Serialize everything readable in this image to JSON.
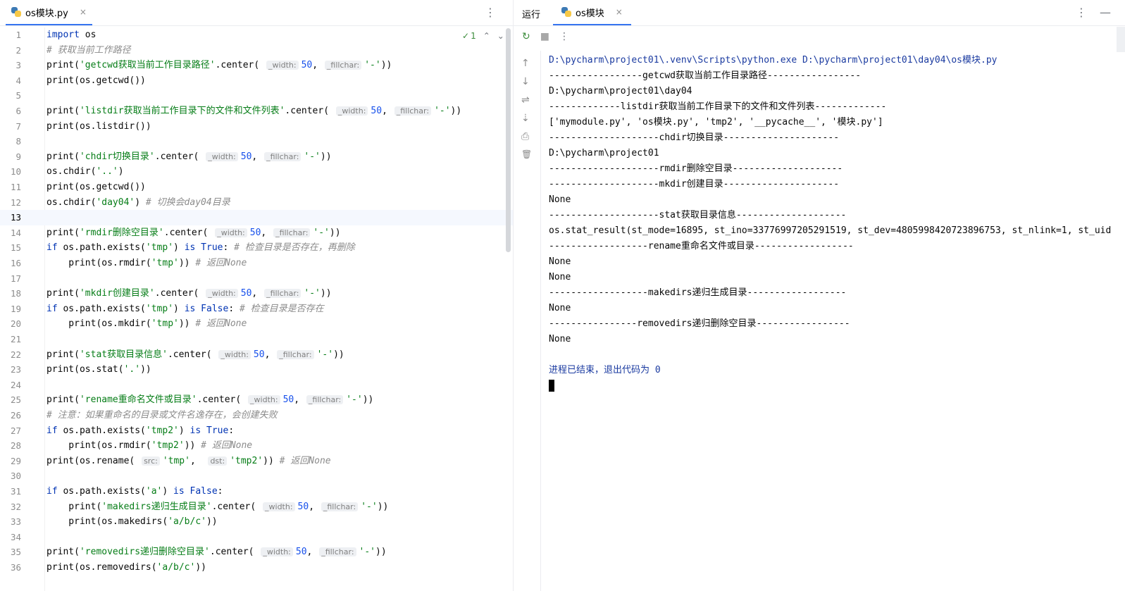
{
  "editor": {
    "tab": {
      "filename": "os模块.py",
      "close": "×"
    },
    "more_icon": "⋮",
    "inspection": {
      "count": "1",
      "up": "⌃",
      "down": "⌄"
    },
    "lines": [
      {
        "n": "1",
        "html": "<span class=\"kw\">import</span> os"
      },
      {
        "n": "2",
        "html": "<span class=\"cm\"># 获取当前工作路径</span>"
      },
      {
        "n": "3",
        "html": "print(<span class=\"str\">'getcwd获取当前工作目录路径'</span>.center( <span class=\"hint\">_width:</span><span class=\"num\">50</span>, <span class=\"hint\">_fillchar:</span><span class=\"str\">'-'</span>))"
      },
      {
        "n": "4",
        "html": "print(os.getcwd())"
      },
      {
        "n": "5",
        "html": ""
      },
      {
        "n": "6",
        "html": "print(<span class=\"str\">'listdir获取当前工作目录下的文件和文件列表'</span>.center( <span class=\"hint\">_width:</span><span class=\"num\">50</span>, <span class=\"hint\">_fillchar:</span><span class=\"str\">'-'</span>))"
      },
      {
        "n": "7",
        "html": "print(os.listdir())"
      },
      {
        "n": "8",
        "html": ""
      },
      {
        "n": "9",
        "html": "print(<span class=\"str\">'chdir切换目录'</span>.center( <span class=\"hint\">_width:</span><span class=\"num\">50</span>, <span class=\"hint\">_fillchar:</span><span class=\"str\">'-'</span>))"
      },
      {
        "n": "10",
        "html": "os.chdir(<span class=\"str\">'..'</span>)"
      },
      {
        "n": "11",
        "html": "print(os.getcwd())"
      },
      {
        "n": "12",
        "html": "os.chdir(<span class=\"str\">'day04'</span>) <span class=\"cm\"># 切换会day04目录</span>"
      },
      {
        "n": "13",
        "html": "",
        "current": true
      },
      {
        "n": "14",
        "html": "print(<span class=\"str\">'rmdir删除空目录'</span>.center( <span class=\"hint\">_width:</span><span class=\"num\">50</span>, <span class=\"hint\">_fillchar:</span><span class=\"str\">'-'</span>))"
      },
      {
        "n": "15",
        "html": "<span class=\"kw\">if</span> os.path.exists(<span class=\"str\">'tmp'</span>) <span class=\"kw\">is</span> <span class=\"kw\">True</span>: <span class=\"cm\"># 检查目录是否存在，再删除</span>"
      },
      {
        "n": "16",
        "html": "    print(os.rmdir(<span class=\"str\">'tmp'</span>)) <span class=\"cm\"># 返回None</span>"
      },
      {
        "n": "17",
        "html": ""
      },
      {
        "n": "18",
        "html": "print(<span class=\"str\">'mkdir创建目录'</span>.center( <span class=\"hint\">_width:</span><span class=\"num\">50</span>, <span class=\"hint\">_fillchar:</span><span class=\"str\">'-'</span>))"
      },
      {
        "n": "19",
        "html": "<span class=\"kw\">if</span> os.path.exists(<span class=\"str\">'tmp'</span>) <span class=\"kw\">is</span> <span class=\"kw\">False</span>: <span class=\"cm\"># 检查目录是否存在</span>"
      },
      {
        "n": "20",
        "html": "    print(os.mkdir(<span class=\"str\">'tmp'</span>)) <span class=\"cm\"># 返回None</span>"
      },
      {
        "n": "21",
        "html": ""
      },
      {
        "n": "22",
        "html": "print(<span class=\"str\">'stat获取目录信息'</span>.center( <span class=\"hint\">_width:</span><span class=\"num\">50</span>, <span class=\"hint\">_fillchar:</span><span class=\"str\">'-'</span>))"
      },
      {
        "n": "23",
        "html": "print(os.stat(<span class=\"str\">'.'</span>))"
      },
      {
        "n": "24",
        "html": ""
      },
      {
        "n": "25",
        "html": "print(<span class=\"str\">'rename重命名文件或目录'</span>.center( <span class=\"hint\">_width:</span><span class=\"num\">50</span>, <span class=\"hint\">_fillchar:</span><span class=\"str\">'-'</span>))"
      },
      {
        "n": "26",
        "html": "<span class=\"cm\"># 注意：如果重命名的目录或文件名逸存在，会创建失败</span>"
      },
      {
        "n": "27",
        "html": "<span class=\"kw\">if</span> os.path.exists(<span class=\"str\">'tmp2'</span>) <span class=\"kw\">is</span> <span class=\"kw\">True</span>:"
      },
      {
        "n": "28",
        "html": "    print(os.rmdir(<span class=\"str\">'tmp2'</span>)) <span class=\"cm\"># 返回None</span>"
      },
      {
        "n": "29",
        "html": "print(os.rename( <span class=\"hint\">src:</span><span class=\"str\">'tmp'</span>,  <span class=\"hint\">dst:</span><span class=\"str\">'tmp2'</span>)) <span class=\"cm\"># 返回None</span>"
      },
      {
        "n": "30",
        "html": ""
      },
      {
        "n": "31",
        "html": "<span class=\"kw\">if</span> os.path.exists(<span class=\"str\">'a'</span>) <span class=\"kw\">is</span> <span class=\"kw\">False</span>:"
      },
      {
        "n": "32",
        "html": "    print(<span class=\"str\">'makedirs递归生成目录'</span>.center( <span class=\"hint\">_width:</span><span class=\"num\">50</span>, <span class=\"hint\">_fillchar:</span><span class=\"str\">'-'</span>))"
      },
      {
        "n": "33",
        "html": "    print(os.makedirs(<span class=\"str\">'a/b/c'</span>))"
      },
      {
        "n": "34",
        "html": ""
      },
      {
        "n": "35",
        "html": "print(<span class=\"str\">'removedirs递归删除空目录'</span>.center( <span class=\"hint\">_width:</span><span class=\"num\">50</span>, <span class=\"hint\">_fillchar:</span><span class=\"str\">'-'</span>))"
      },
      {
        "n": "36",
        "html": "print(os.removedirs(<span class=\"str\">'a/b/c'</span>))"
      }
    ]
  },
  "run": {
    "label": "运行",
    "tab": {
      "title": "os模块",
      "close": "×"
    },
    "more_icon": "⋮",
    "minimize_icon": "—",
    "toolbar": {
      "rerun": "↻",
      "stop": "■",
      "more": "⋮"
    },
    "side_icons": [
      "↑",
      "↓",
      "⇌",
      "⇣",
      "⎙",
      "🗑"
    ],
    "console": [
      {
        "t": "D:\\pycharm\\project01\\.venv\\Scripts\\python.exe D:\\pycharm\\project01\\day04\\os模块.py",
        "cls": "path"
      },
      {
        "t": "-----------------getcwd获取当前工作目录路径-----------------"
      },
      {
        "t": "D:\\pycharm\\project01\\day04"
      },
      {
        "t": "-------------listdir获取当前工作目录下的文件和文件列表-------------"
      },
      {
        "t": "['mymodule.py', 'os模块.py', 'tmp2', '__pycache__', '模块.py']"
      },
      {
        "t": "--------------------chdir切换目录---------------------"
      },
      {
        "t": "D:\\pycharm\\project01"
      },
      {
        "t": "--------------------rmdir删除空目录--------------------"
      },
      {
        "t": "--------------------mkdir创建目录---------------------"
      },
      {
        "t": "None"
      },
      {
        "t": "--------------------stat获取目录信息--------------------"
      },
      {
        "t": "os.stat_result(st_mode=16895, st_ino=33776997205291519, st_dev=4805998420723896753, st_nlink=1, st_uid"
      },
      {
        "t": "------------------rename重命名文件或目录------------------"
      },
      {
        "t": "None"
      },
      {
        "t": "None"
      },
      {
        "t": "------------------makedirs递归生成目录------------------"
      },
      {
        "t": "None"
      },
      {
        "t": "----------------removedirs递归删除空目录-----------------"
      },
      {
        "t": "None"
      },
      {
        "t": ""
      },
      {
        "t": "进程已结束，退出代码为 0",
        "cls": "exit"
      }
    ]
  },
  "colors": {
    "accent": "#3574f0",
    "keyword": "#0033b3",
    "string": "#067d17",
    "number": "#1750eb",
    "comment": "#8c8c8c"
  }
}
